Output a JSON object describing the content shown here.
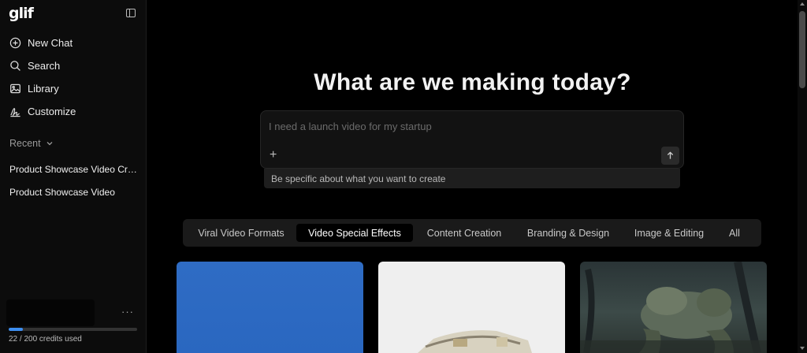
{
  "app": {
    "logo": "glif"
  },
  "sidebar": {
    "nav": [
      {
        "label": "New Chat",
        "icon": "plus-circle-icon"
      },
      {
        "label": "Search",
        "icon": "search-icon"
      },
      {
        "label": "Library",
        "icon": "image-icon"
      },
      {
        "label": "Customize",
        "icon": "signature-icon"
      }
    ],
    "recent_label": "Recent",
    "recent": [
      {
        "label": "Product Showcase Video Creation"
      },
      {
        "label": "Product Showcase Video"
      }
    ],
    "more_label": "···",
    "credits": {
      "used": 22,
      "total": 200,
      "text": "22 / 200 credits used"
    }
  },
  "main": {
    "headline": "What are we making today?",
    "prompt": {
      "placeholder": "I need a launch video for my startup",
      "value": ""
    },
    "hint": "Be specific about what you want to create",
    "tabs": [
      {
        "label": "Viral Video Formats",
        "active": false
      },
      {
        "label": "Video Special Effects",
        "active": true
      },
      {
        "label": "Content Creation",
        "active": false
      },
      {
        "label": "Branding & Design",
        "active": false
      },
      {
        "label": "Image & Editing",
        "active": false
      },
      {
        "label": "All",
        "active": false
      }
    ]
  },
  "colors": {
    "accent": "#3d8ef0",
    "background": "#000000",
    "sidebar": "#0c0c0c"
  }
}
